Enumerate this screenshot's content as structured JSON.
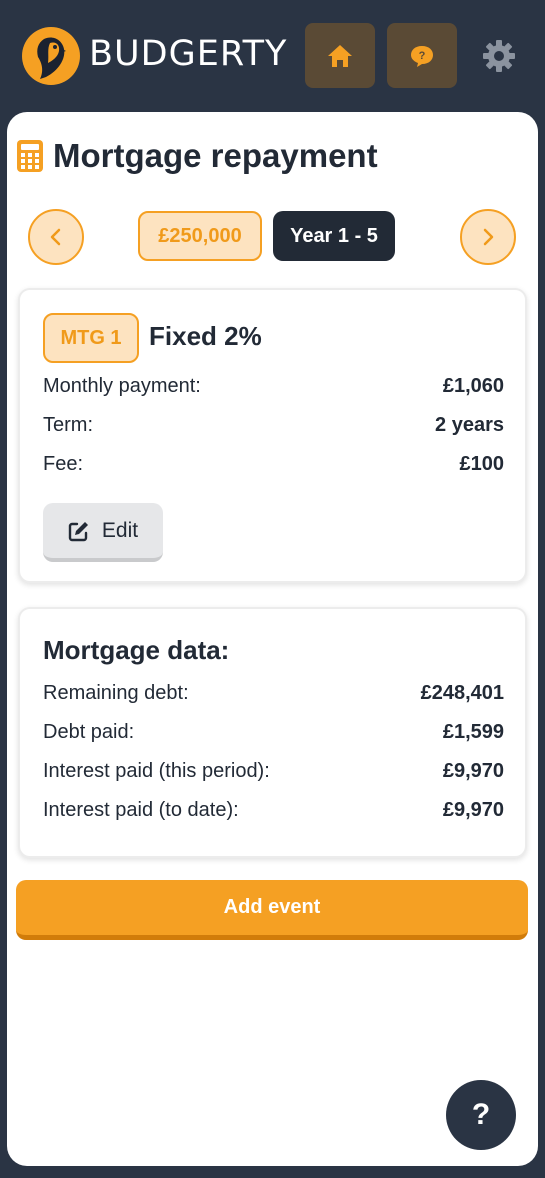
{
  "app": {
    "brand": "BUDGERTY",
    "brand_color": "#f5a023",
    "header_bg": "#2a3444"
  },
  "header": {
    "home_icon": "home-icon",
    "chat_icon": "chat-question-icon",
    "settings_icon": "gear-icon"
  },
  "page": {
    "title": "Mortgage repayment",
    "title_icon": "calculator-icon"
  },
  "nav": {
    "amount": "£250,000",
    "period": "Year 1 - 5"
  },
  "mortgage": {
    "badge": "MTG 1",
    "name": "Fixed 2%",
    "rows": [
      {
        "label": "Monthly payment:",
        "value": "£1,060"
      },
      {
        "label": "Term:",
        "value": "2 years"
      },
      {
        "label": "Fee:",
        "value": "£100"
      }
    ],
    "edit_label": "Edit"
  },
  "mortgage_data": {
    "title": "Mortgage data:",
    "rows": [
      {
        "label": "Remaining debt:",
        "value": "£248,401"
      },
      {
        "label": "Debt paid:",
        "value": "£1,599"
      },
      {
        "label": "Interest paid (this period):",
        "value": "£9,970"
      },
      {
        "label": "Interest paid (to date):",
        "value": "£9,970"
      }
    ]
  },
  "actions": {
    "add_event": "Add event",
    "help": "?"
  }
}
